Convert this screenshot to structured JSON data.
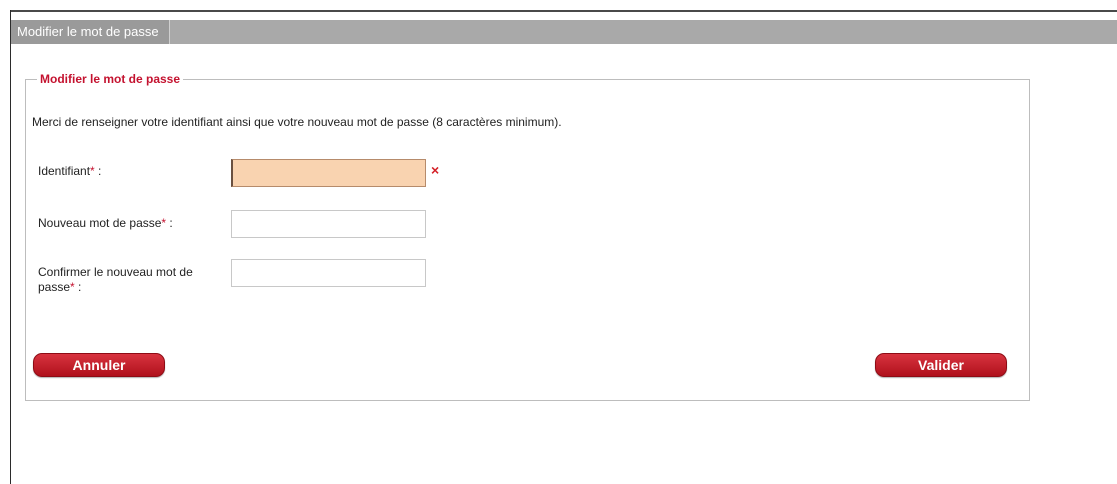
{
  "window": {
    "title": "Modifier le mot de passe"
  },
  "form": {
    "legend": "Modifier le mot de passe",
    "intro": "Merci de renseigner votre identifiant ainsi que votre nouveau mot de passe (8 caractères minimum).",
    "required_mark": "*",
    "fields": {
      "identifiant": {
        "label": "Identifiant",
        "suffix": " :",
        "value": "",
        "error_icon": "error-cross-icon",
        "error_symbol": "×"
      },
      "new_password": {
        "label": "Nouveau mot de passe",
        "suffix": " :",
        "value": ""
      },
      "confirm_password": {
        "label": "Confirmer le nouveau mot de passe",
        "suffix": " :",
        "value": ""
      }
    },
    "buttons": {
      "cancel": "Annuler",
      "submit": "Valider"
    }
  },
  "colors": {
    "accent": "#c4122f",
    "button": "#c41a26",
    "error_field": "#f9d3b0",
    "title_bar": "#a9a9a9"
  }
}
